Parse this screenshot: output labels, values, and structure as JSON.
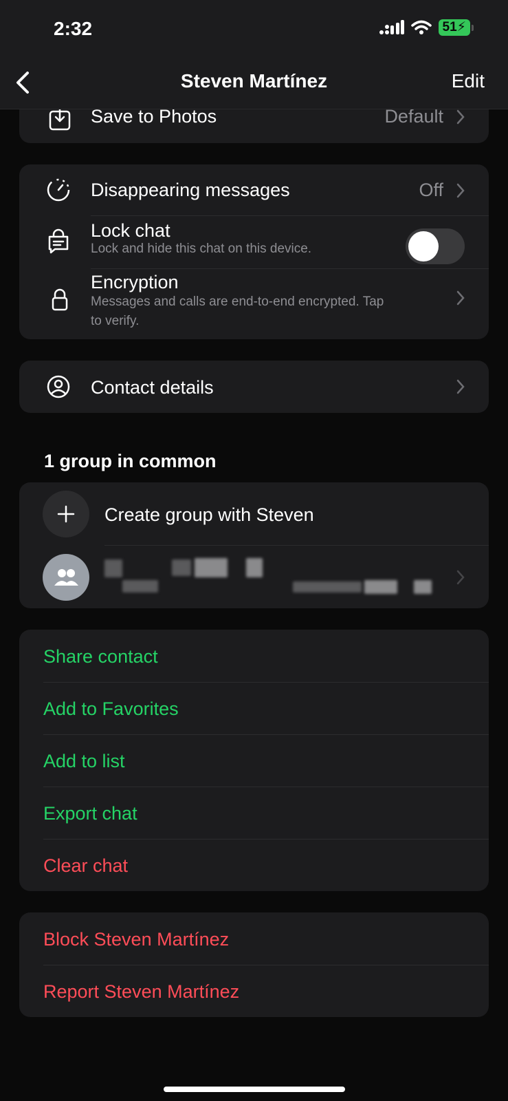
{
  "status_bar": {
    "time": "2:32",
    "battery": "51"
  },
  "nav": {
    "title": "Steven Martínez",
    "edit_label": "Edit"
  },
  "media": {
    "save_to_photos_label": "Save to Photos",
    "save_to_photos_value": "Default"
  },
  "privacy": {
    "disappearing_label": "Disappearing messages",
    "disappearing_value": "Off",
    "lock_label": "Lock chat",
    "lock_sub": "Lock and hide this chat on this device.",
    "lock_enabled": false,
    "encryption_label": "Encryption",
    "encryption_sub_line1": "Messages and calls are end-to-end encrypted. Tap",
    "encryption_sub_line2": "to verify."
  },
  "contact": {
    "details_label": "Contact details"
  },
  "groups": {
    "header": "1 group in common",
    "create_label": "Create group with Steven"
  },
  "actions": {
    "share": "Share contact",
    "favorites": "Add to Favorites",
    "list": "Add to list",
    "export": "Export chat",
    "clear": "Clear chat"
  },
  "danger": {
    "block": "Block Steven Martínez",
    "report": "Report Steven Martínez"
  },
  "colors": {
    "accent_green": "#25d366",
    "destructive_red": "#ff4d58",
    "card_bg": "#1c1c1e"
  }
}
